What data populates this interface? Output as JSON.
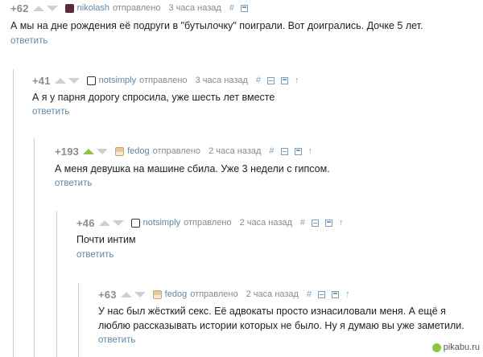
{
  "comments": [
    {
      "rating": "+62",
      "author": "nikolash",
      "sent": "отправлено",
      "time": "3 часа назад",
      "text": "А мы на дне рождения её подруги в \"бутылочку\" поиграли. Вот доигрались. Дочке 5 лет.",
      "reply": "ответить"
    },
    {
      "rating": "+41",
      "author": "notsimply",
      "sent": "отправлено",
      "time": "3 часа назад",
      "text": "А я у парня дорогу спросила, уже шесть лет вместе",
      "reply": "ответить"
    },
    {
      "rating": "+193",
      "author": "fedog",
      "sent": "отправлено",
      "time": "2 часа назад",
      "text": "А меня девушка на машине сбила. Уже 3 недели с гипсом.",
      "reply": "ответить"
    },
    {
      "rating": "+46",
      "author": "notsimply",
      "sent": "отправлено",
      "time": "2 часа назад",
      "text": "Почти интим",
      "reply": "ответить"
    },
    {
      "rating": "+63",
      "author": "fedog",
      "sent": "отправлено",
      "time": "2 часа назад",
      "text_line1": "У нас был жёсткий секс. Её адвокаты просто изнасиловали меня. А ещё я",
      "text_line2": "люблю рассказывать истории которых не было. Ну я думаю вы уже заметили.",
      "reply": "ответить"
    }
  ],
  "tools": {
    "hash": "#",
    "up": "↑"
  },
  "watermark": "pikabu.ru",
  "colors": {
    "link": "#5f86a7",
    "upvote_active": "#8cc63f",
    "thread_line": "#cfcfcf"
  }
}
